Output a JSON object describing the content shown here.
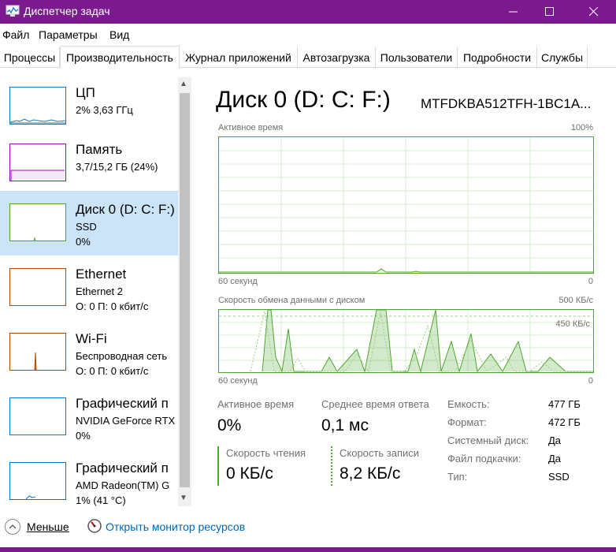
{
  "window": {
    "title": "Диспетчер задач"
  },
  "menu": [
    "Файл",
    "Параметры",
    "Вид"
  ],
  "tabs": [
    "Процессы",
    "Производительность",
    "Журнал приложений",
    "Автозагрузка",
    "Пользователи",
    "Подробности",
    "Службы"
  ],
  "sidebar": {
    "items": [
      {
        "title": "ЦП",
        "sub": "2%  3,63 ГГц",
        "sub2": "",
        "color": "#117dbb"
      },
      {
        "title": "Память",
        "sub": "3,7/15,2 ГБ (24%)",
        "sub2": "",
        "color": "#8b12ae"
      },
      {
        "title": "Диск 0 (D: C: F:)",
        "sub": "SSD",
        "sub2": "0%",
        "color": "#4ea72e"
      },
      {
        "title": "Ethernet",
        "sub": "Ethernet 2",
        "sub2": "О: 0 П: 0 кбит/с",
        "color": "#a74f01"
      },
      {
        "title": "Wi-Fi",
        "sub": "Беспроводная сеть",
        "sub2": "О: 0 П: 0 кбит/с",
        "color": "#a74f01"
      },
      {
        "title": "Графический п",
        "sub": "NVIDIA GeForce RTX",
        "sub2": "0%",
        "color": "#0078d7"
      },
      {
        "title": "Графический п",
        "sub": "AMD Radeon(TM) G",
        "sub2": "1% (41 °C)",
        "color": "#0078d7"
      }
    ]
  },
  "main": {
    "title": "Диск 0 (D: C: F:)",
    "model": "MTFDKBA512TFH-1BC1A...",
    "graph1": {
      "label": "Активное время",
      "max": "100%",
      "time": "60 секунд",
      "min": "0"
    },
    "graph2": {
      "label": "Скорость обмена данными с диском",
      "max": "500 КБ/с",
      "mid": "450 КБ/с",
      "time": "60 секунд",
      "min": "0"
    },
    "stats": {
      "active_label": "Активное время",
      "active_value": "0%",
      "response_label": "Среднее время ответа",
      "response_value": "0,1 мс",
      "read_label": "Скорость чтения",
      "read_value": "0 КБ/с",
      "write_label": "Скорость записи",
      "write_value": "8,2 КБ/с"
    },
    "props": [
      {
        "label": "Емкость:",
        "value": "477 ГБ"
      },
      {
        "label": "Формат:",
        "value": "472 ГБ"
      },
      {
        "label": "Системный диск:",
        "value": "Да"
      },
      {
        "label": "Файл подкачки:",
        "value": "Да"
      },
      {
        "label": "Тип:",
        "value": "SSD"
      }
    ]
  },
  "footer": {
    "fewer": "Меньше",
    "resource_monitor": "Открыть монитор ресурсов"
  }
}
